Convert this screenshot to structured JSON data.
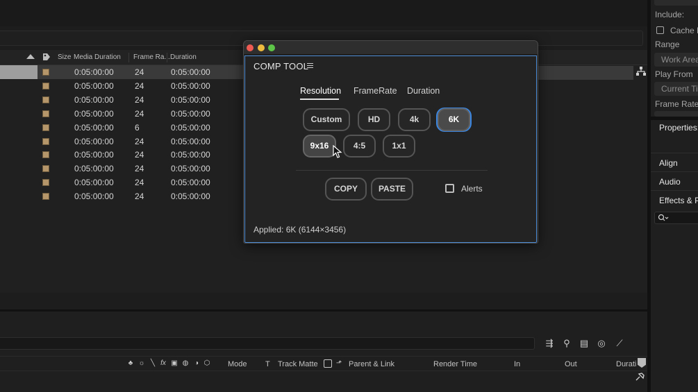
{
  "project": {
    "columns": {
      "size": "Size",
      "media_duration": "Media Duration",
      "frame_rate": "Frame Ra...",
      "duration": "Duration"
    },
    "rows": [
      {
        "media_duration": "0:05:00:00",
        "frame_rate": "24",
        "duration": "0:05:00:00"
      },
      {
        "media_duration": "0:05:00:00",
        "frame_rate": "24",
        "duration": "0:05:00:00"
      },
      {
        "media_duration": "0:05:00:00",
        "frame_rate": "24",
        "duration": "0:05:00:00"
      },
      {
        "media_duration": "0:05:00:00",
        "frame_rate": "24",
        "duration": "0:05:00:00"
      },
      {
        "media_duration": "0:05:00:00",
        "frame_rate": "6",
        "duration": "0:05:00:00"
      },
      {
        "media_duration": "0:05:00:00",
        "frame_rate": "24",
        "duration": "0:05:00:00"
      },
      {
        "media_duration": "0:05:00:00",
        "frame_rate": "24",
        "duration": "0:05:00:00"
      },
      {
        "media_duration": "0:05:00:00",
        "frame_rate": "24",
        "duration": "0:05:00:00"
      },
      {
        "media_duration": "0:05:00:00",
        "frame_rate": "24",
        "duration": "0:05:00:00"
      },
      {
        "media_duration": "0:05:00:00",
        "frame_rate": "24",
        "duration": "0:05:00:00"
      }
    ],
    "label_color": "#b5966a"
  },
  "dialog": {
    "title": "COMP TOOL",
    "tabs": [
      "Resolution",
      "FrameRate",
      "Duration"
    ],
    "active_tab": "Resolution",
    "presets_row1": [
      "Custom",
      "HD",
      "4k",
      "6K"
    ],
    "presets_row2": [
      "9x16",
      "4:5",
      "1x1"
    ],
    "active_preset": "6K",
    "copy_label": "COPY",
    "paste_label": "PASTE",
    "alerts_label": "Alerts",
    "alerts_checked": false,
    "status": "Applied: 6K (6144×3456)",
    "accent_color": "#3b86e0"
  },
  "timeline": {
    "mode": "Mode",
    "t": "T",
    "track_matte": "Track Matte",
    "parent_link": "Parent & Link",
    "render_time": "Render Time",
    "in": "In",
    "out": "Out",
    "duration": "Durati"
  },
  "right_panel": {
    "include": "Include:",
    "cache": "Cache B",
    "range": "Range",
    "range_value": "Work Area",
    "play_from": "Play From",
    "play_from_value": "Current Ti",
    "frame_rate": "Frame Rate",
    "properties": "Properties:",
    "align": "Align",
    "audio": "Audio",
    "effects": "Effects & P"
  }
}
